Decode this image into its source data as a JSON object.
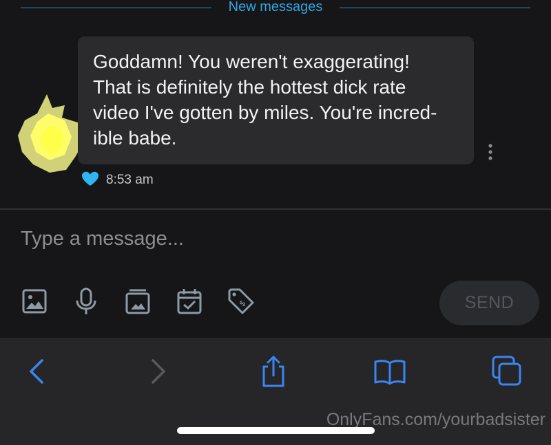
{
  "chat": {
    "divider_label": "New messages",
    "message": {
      "text": "Goddamn! You weren't exaggerating!\nThat is definitely the hottest dick rate\nvideo I've gotten by miles. You're incred-\nible babe.",
      "time": "8:53 am",
      "liked": true
    }
  },
  "composer": {
    "placeholder": "Type a message...",
    "value": "",
    "tools": [
      "image-icon",
      "microphone-icon",
      "media-vault-icon",
      "calendar-check-icon",
      "price-tag-icon"
    ],
    "send_label": "SEND"
  },
  "browser": {
    "buttons": [
      "back-chevron-icon",
      "forward-chevron-icon",
      "share-icon",
      "bookmarks-book-icon",
      "tabs-icon"
    ],
    "watermark": "OnlyFans.com/yourbadsister"
  },
  "colors": {
    "accent": "#2fa5e0",
    "ios_blue": "#3a86f0",
    "bubble": "#2b2b2e",
    "background": "#161618",
    "toolbar": "#262628",
    "heart": "#2fb5f2"
  }
}
